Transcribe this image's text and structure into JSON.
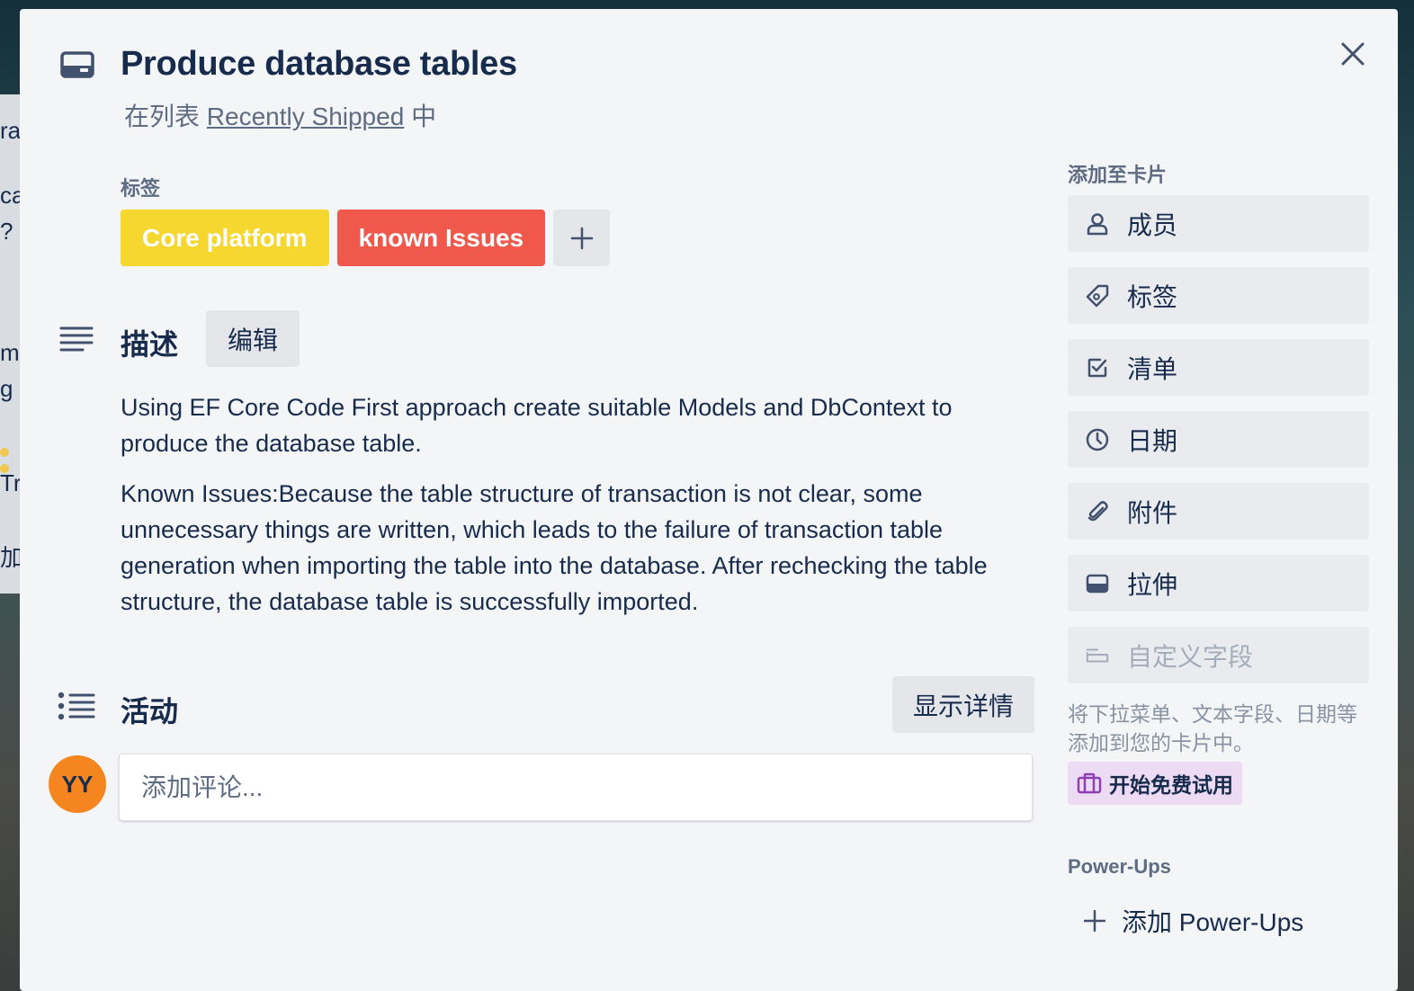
{
  "card": {
    "title": "Produce database tables",
    "list_prefix": "在列表",
    "list_name": "Recently Shipped",
    "list_suffix": "中"
  },
  "labels": {
    "heading": "标签",
    "items": [
      {
        "text": "Core platform",
        "color": "#f5d730"
      },
      {
        "text": "known Issues",
        "color": "#f0584b"
      }
    ]
  },
  "description": {
    "heading": "描述",
    "edit_label": "编辑",
    "paragraphs": [
      "Using EF Core Code First approach create suitable Models and DbContext to produce the database table.",
      "Known Issues:Because the table structure of transaction is not clear, some unnecessary things are written, which leads to the failure of transaction table generation when importing the table into the database. After rechecking the table structure, the database table is successfully imported."
    ]
  },
  "activity": {
    "heading": "活动",
    "show_details_label": "显示详情",
    "avatar_initials": "YY",
    "comment_placeholder": "添加评论..."
  },
  "sidebar": {
    "add_heading": "添加至卡片",
    "buttons": [
      {
        "label": "成员",
        "icon": "person-icon"
      },
      {
        "label": "标签",
        "icon": "tag-icon"
      },
      {
        "label": "清单",
        "icon": "checklist-icon"
      },
      {
        "label": "日期",
        "icon": "clock-icon"
      },
      {
        "label": "附件",
        "icon": "paperclip-icon"
      },
      {
        "label": "拉伸",
        "icon": "cover-icon"
      },
      {
        "label": "自定义字段",
        "icon": "custom-field-icon"
      }
    ],
    "custom_fields_hint": "将下拉菜单、文本字段、日期等添加到您的卡片中。",
    "trial_label": "开始免费试用",
    "powerups_heading": "Power-Ups",
    "add_powerups_label": "添加 Power-Ups"
  },
  "background": {
    "fragments": [
      "ra",
      "ca",
      "?",
      "ma",
      "g a",
      "Tr",
      "加"
    ]
  }
}
